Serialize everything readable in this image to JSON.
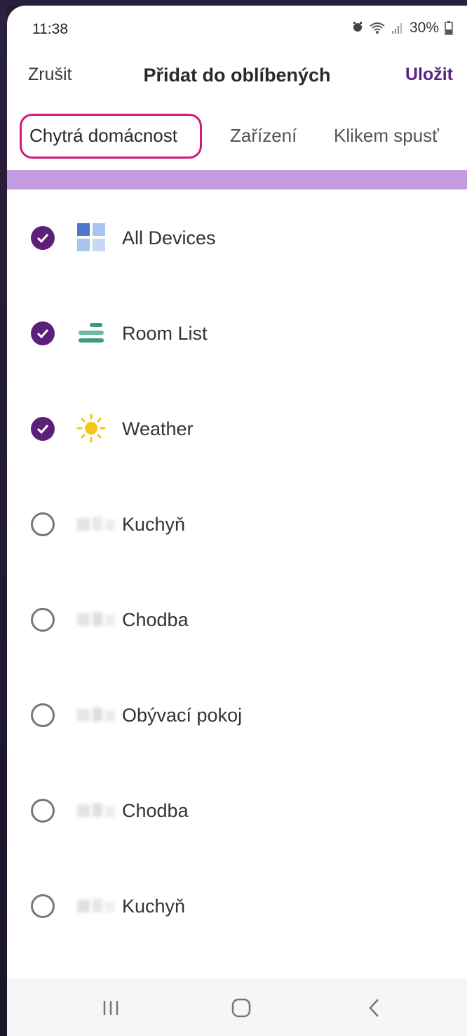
{
  "status": {
    "time": "11:38",
    "battery": "30%"
  },
  "header": {
    "cancel": "Zrušit",
    "title": "Přidat do oblíbených",
    "save": "Uložit"
  },
  "tabs": [
    {
      "label": "Chytrá domácnost",
      "active": true
    },
    {
      "label": "Zařízení",
      "active": false
    },
    {
      "label": "Klikem spusť",
      "active": false
    }
  ],
  "items": [
    {
      "label": "All Devices",
      "checked": true,
      "icon": "all-devices-icon"
    },
    {
      "label": "Room List",
      "checked": true,
      "icon": "room-list-icon"
    },
    {
      "label": "Weather",
      "checked": true,
      "icon": "weather-sun-icon"
    },
    {
      "label": "Kuchyň",
      "checked": false,
      "icon": "blurred-room-icon"
    },
    {
      "label": "Chodba",
      "checked": false,
      "icon": "blurred-room-icon"
    },
    {
      "label": "Obývací pokoj",
      "checked": false,
      "icon": "blurred-room-icon"
    },
    {
      "label": "Chodba",
      "checked": false,
      "icon": "blurred-room-icon"
    },
    {
      "label": "Kuchyň",
      "checked": false,
      "icon": "blurred-room-icon"
    }
  ],
  "colors": {
    "accent": "#5e1f7a",
    "save": "#5b2386",
    "highlight": "#d6177d",
    "tab_bar": "#c39be0"
  }
}
